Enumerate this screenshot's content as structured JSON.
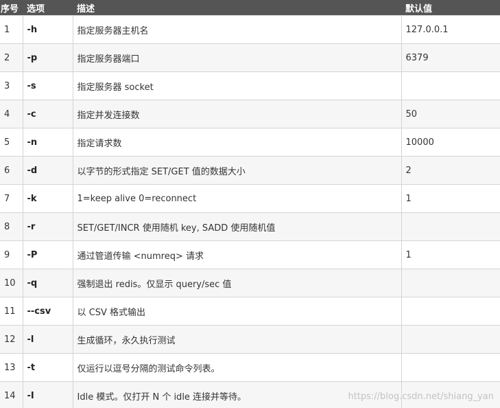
{
  "table": {
    "headers": [
      "序号",
      "选项",
      "描述",
      "默认值"
    ],
    "rows": [
      {
        "no": "1",
        "option": "-h",
        "desc": "指定服务器主机名",
        "default": "127.0.0.1"
      },
      {
        "no": "2",
        "option": "-p",
        "desc": "指定服务器端口",
        "default": "6379"
      },
      {
        "no": "3",
        "option": "-s",
        "desc": "指定服务器 socket",
        "default": ""
      },
      {
        "no": "4",
        "option": "-c",
        "desc": "指定并发连接数",
        "default": "50"
      },
      {
        "no": "5",
        "option": "-n",
        "desc": "指定请求数",
        "default": "10000"
      },
      {
        "no": "6",
        "option": "-d",
        "desc": "以字节的形式指定 SET/GET 值的数据大小",
        "default": "2"
      },
      {
        "no": "7",
        "option": "-k",
        "desc": "1=keep alive 0=reconnect",
        "default": "1"
      },
      {
        "no": "8",
        "option": "-r",
        "desc": "SET/GET/INCR 使用随机 key, SADD 使用随机值",
        "default": ""
      },
      {
        "no": "9",
        "option": "-P",
        "desc": "通过管道传输 <numreq> 请求",
        "default": "1"
      },
      {
        "no": "10",
        "option": "-q",
        "desc": "强制退出 redis。仅显示 query/sec 值",
        "default": ""
      },
      {
        "no": "11",
        "option": "--csv",
        "desc": "以 CSV 格式输出",
        "default": ""
      },
      {
        "no": "12",
        "option": "-l",
        "desc": "生成循环，永久执行测试",
        "default": ""
      },
      {
        "no": "13",
        "option": "-t",
        "desc": "仅运行以逗号分隔的测试命令列表。",
        "default": ""
      },
      {
        "no": "14",
        "option": "-I",
        "desc": "Idle 模式。仅打开 N 个 idle 连接并等待。",
        "default": ""
      }
    ]
  },
  "watermark": "https://blog.csdn.net/shiang_yan"
}
